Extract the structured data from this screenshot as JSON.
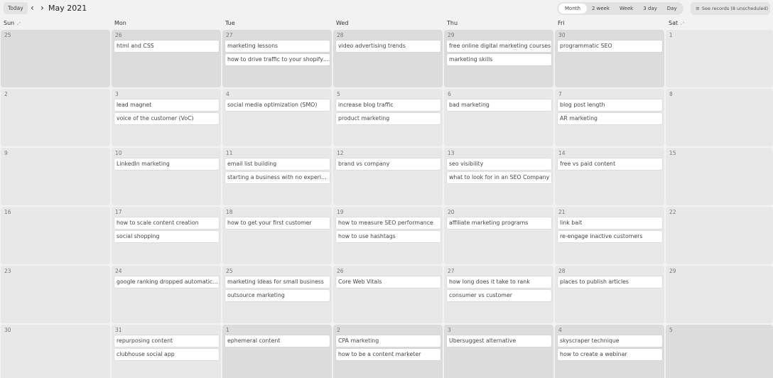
{
  "toolbar": {
    "today_label": "Today",
    "prev_icon": "‹",
    "next_icon": "›",
    "month_title": "May 2021",
    "views": [
      "Month",
      "2 week",
      "Week",
      "3 day",
      "Day"
    ],
    "active_view": "Month",
    "see_records_icon": "≡",
    "see_records_label": "See records (8 unscheduled)"
  },
  "weekdays": [
    "Sun",
    "Mon",
    "Tue",
    "Wed",
    "Thu",
    "Fri",
    "Sat"
  ],
  "weeks": [
    [
      {
        "day": "25",
        "other": true,
        "records": []
      },
      {
        "day": "26",
        "other": true,
        "records": [
          "html and CSS"
        ]
      },
      {
        "day": "27",
        "other": true,
        "records": [
          "marketing lessons",
          "how to drive traffic to your shopify store"
        ]
      },
      {
        "day": "28",
        "other": true,
        "records": [
          "video advertising trends"
        ]
      },
      {
        "day": "29",
        "other": true,
        "records": [
          "free online digital marketing courses",
          "marketing skills"
        ]
      },
      {
        "day": "30",
        "other": true,
        "records": [
          "programmatic SEO"
        ]
      },
      {
        "day": "1",
        "other": false,
        "records": []
      }
    ],
    [
      {
        "day": "2",
        "other": false,
        "records": []
      },
      {
        "day": "3",
        "other": false,
        "records": [
          "lead magnet",
          "voice of the customer (VoC)"
        ]
      },
      {
        "day": "4",
        "other": false,
        "records": [
          "social media optimization (SMO)"
        ]
      },
      {
        "day": "5",
        "other": false,
        "records": [
          "increase blog traffic",
          "product marketing"
        ]
      },
      {
        "day": "6",
        "other": false,
        "records": [
          "bad marketing"
        ]
      },
      {
        "day": "7",
        "other": false,
        "records": [
          "blog post length",
          "AR marketing"
        ]
      },
      {
        "day": "8",
        "other": false,
        "records": []
      }
    ],
    [
      {
        "day": "9",
        "other": false,
        "records": []
      },
      {
        "day": "10",
        "other": false,
        "records": [
          "LinkedIn marketing"
        ]
      },
      {
        "day": "11",
        "other": false,
        "records": [
          "email list building",
          "starting a business with no experience"
        ]
      },
      {
        "day": "12",
        "other": false,
        "records": [
          "brand vs company"
        ]
      },
      {
        "day": "13",
        "other": false,
        "records": [
          "seo visibility",
          "what to look for in an SEO Company"
        ]
      },
      {
        "day": "14",
        "other": false,
        "records": [
          "free vs paid content"
        ]
      },
      {
        "day": "15",
        "other": false,
        "records": []
      }
    ],
    [
      {
        "day": "16",
        "other": false,
        "records": []
      },
      {
        "day": "17",
        "other": false,
        "records": [
          "how to scale content creation",
          "social shopping"
        ]
      },
      {
        "day": "18",
        "other": false,
        "records": [
          "how to get your first customer"
        ]
      },
      {
        "day": "19",
        "other": false,
        "records": [
          "how to measure SEO performance",
          "how to use hashtags"
        ]
      },
      {
        "day": "20",
        "other": false,
        "records": [
          "affiliate marketing programs"
        ]
      },
      {
        "day": "21",
        "other": false,
        "records": [
          "link bait",
          "re-engage inactive customers"
        ]
      },
      {
        "day": "22",
        "other": false,
        "records": []
      }
    ],
    [
      {
        "day": "23",
        "other": false,
        "records": []
      },
      {
        "day": "24",
        "other": false,
        "records": [
          "google ranking dropped automatically"
        ]
      },
      {
        "day": "25",
        "other": false,
        "records": [
          "marketing ideas for small business",
          "outsource marketing"
        ]
      },
      {
        "day": "26",
        "other": false,
        "records": [
          "Core Web Vitals"
        ]
      },
      {
        "day": "27",
        "other": false,
        "records": [
          "how long does it take to rank",
          "consumer vs customer"
        ]
      },
      {
        "day": "28",
        "other": false,
        "records": [
          "places to publish articles"
        ]
      },
      {
        "day": "29",
        "other": false,
        "records": []
      }
    ],
    [
      {
        "day": "30",
        "other": false,
        "records": []
      },
      {
        "day": "31",
        "other": false,
        "records": [
          "repurposing content",
          "clubhouse social app"
        ]
      },
      {
        "day": "1",
        "other": true,
        "records": [
          "ephemeral content"
        ]
      },
      {
        "day": "2",
        "other": true,
        "records": [
          "CPA marketing",
          "how to be a content marketer"
        ]
      },
      {
        "day": "3",
        "other": true,
        "records": [
          "Ubersuggest alternative"
        ]
      },
      {
        "day": "4",
        "other": true,
        "records": [
          "skyscraper technique",
          "how to create a webinar"
        ]
      },
      {
        "day": "5",
        "other": true,
        "records": []
      }
    ]
  ]
}
